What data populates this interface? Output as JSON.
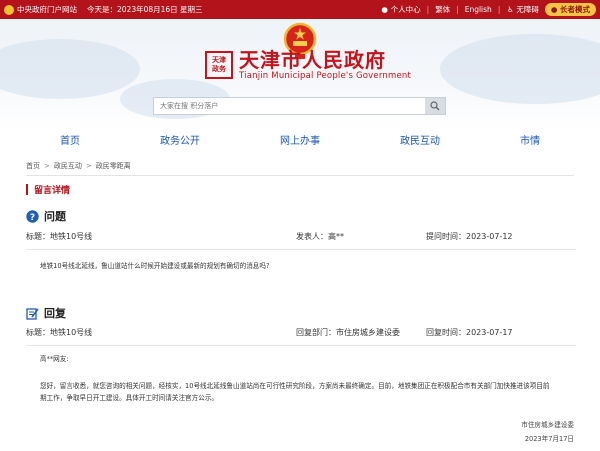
{
  "topbar": {
    "gov_portal": "中央政府门户网站",
    "today": "今天是：2023年08月16日 星期三",
    "personal_center": "个人中心",
    "traditional": "繁体",
    "english": "English",
    "accessibility": "无障碍",
    "elder_mode": "长者模式"
  },
  "header": {
    "seal_text": "天津市人民政府",
    "title_cn": "天津市人民政府",
    "title_en": "Tianjin Municipal People's Government",
    "search_placeholder": "大家在搜 积分落户"
  },
  "nav": [
    "首页",
    "政务公开",
    "网上办事",
    "政民互动",
    "市情"
  ],
  "breadcrumb": [
    "首页",
    "政民互动",
    "政民零距离"
  ],
  "section_title": "留言详情",
  "question": {
    "heading": "问题",
    "title_label": "标题：",
    "title": "地铁10号线",
    "sender_label": "发表人：",
    "sender": "高**",
    "time_label": "提问时间：",
    "time": "2023-07-12",
    "content": "地铁10号线北延线，鲁山道站什么时候开始建设或最新的规划有确切的消息吗?"
  },
  "reply": {
    "heading": "回复",
    "title_label": "标题：",
    "title": "地铁10号线",
    "dept_label": "回复部门：",
    "dept": "市住房城乡建设委",
    "time_label": "回复时间：",
    "time": "2023-07-17",
    "greeting": "高**网友:",
    "content_line1": "您好，留言收悉，就您咨询的相关问题，经核实，10号线北延线鲁山道站尚在可行性研究阶段，方案尚未最终确定。目前，地铁集团正在积极配合市有关部门加快推进该项目前",
    "content_line2": "期工作，争取早日开工建设。具体开工时间请关注官方公示。",
    "sign_dept": "市住房城乡建设委",
    "sign_date": "2023年7月17日"
  }
}
